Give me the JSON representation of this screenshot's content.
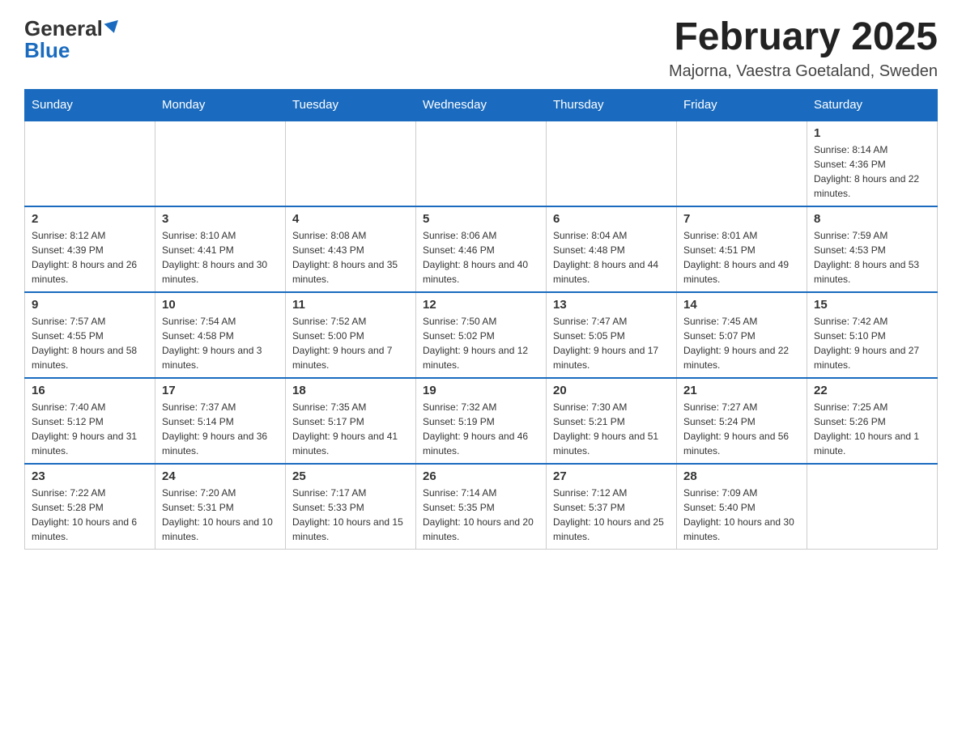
{
  "header": {
    "logo_main": "General",
    "logo_accent": "Blue",
    "month_title": "February 2025",
    "location": "Majorna, Vaestra Goetaland, Sweden"
  },
  "days_of_week": [
    "Sunday",
    "Monday",
    "Tuesday",
    "Wednesday",
    "Thursday",
    "Friday",
    "Saturday"
  ],
  "weeks": [
    [
      {
        "num": "",
        "info": ""
      },
      {
        "num": "",
        "info": ""
      },
      {
        "num": "",
        "info": ""
      },
      {
        "num": "",
        "info": ""
      },
      {
        "num": "",
        "info": ""
      },
      {
        "num": "",
        "info": ""
      },
      {
        "num": "1",
        "info": "Sunrise: 8:14 AM\nSunset: 4:36 PM\nDaylight: 8 hours and 22 minutes."
      }
    ],
    [
      {
        "num": "2",
        "info": "Sunrise: 8:12 AM\nSunset: 4:39 PM\nDaylight: 8 hours and 26 minutes."
      },
      {
        "num": "3",
        "info": "Sunrise: 8:10 AM\nSunset: 4:41 PM\nDaylight: 8 hours and 30 minutes."
      },
      {
        "num": "4",
        "info": "Sunrise: 8:08 AM\nSunset: 4:43 PM\nDaylight: 8 hours and 35 minutes."
      },
      {
        "num": "5",
        "info": "Sunrise: 8:06 AM\nSunset: 4:46 PM\nDaylight: 8 hours and 40 minutes."
      },
      {
        "num": "6",
        "info": "Sunrise: 8:04 AM\nSunset: 4:48 PM\nDaylight: 8 hours and 44 minutes."
      },
      {
        "num": "7",
        "info": "Sunrise: 8:01 AM\nSunset: 4:51 PM\nDaylight: 8 hours and 49 minutes."
      },
      {
        "num": "8",
        "info": "Sunrise: 7:59 AM\nSunset: 4:53 PM\nDaylight: 8 hours and 53 minutes."
      }
    ],
    [
      {
        "num": "9",
        "info": "Sunrise: 7:57 AM\nSunset: 4:55 PM\nDaylight: 8 hours and 58 minutes."
      },
      {
        "num": "10",
        "info": "Sunrise: 7:54 AM\nSunset: 4:58 PM\nDaylight: 9 hours and 3 minutes."
      },
      {
        "num": "11",
        "info": "Sunrise: 7:52 AM\nSunset: 5:00 PM\nDaylight: 9 hours and 7 minutes."
      },
      {
        "num": "12",
        "info": "Sunrise: 7:50 AM\nSunset: 5:02 PM\nDaylight: 9 hours and 12 minutes."
      },
      {
        "num": "13",
        "info": "Sunrise: 7:47 AM\nSunset: 5:05 PM\nDaylight: 9 hours and 17 minutes."
      },
      {
        "num": "14",
        "info": "Sunrise: 7:45 AM\nSunset: 5:07 PM\nDaylight: 9 hours and 22 minutes."
      },
      {
        "num": "15",
        "info": "Sunrise: 7:42 AM\nSunset: 5:10 PM\nDaylight: 9 hours and 27 minutes."
      }
    ],
    [
      {
        "num": "16",
        "info": "Sunrise: 7:40 AM\nSunset: 5:12 PM\nDaylight: 9 hours and 31 minutes."
      },
      {
        "num": "17",
        "info": "Sunrise: 7:37 AM\nSunset: 5:14 PM\nDaylight: 9 hours and 36 minutes."
      },
      {
        "num": "18",
        "info": "Sunrise: 7:35 AM\nSunset: 5:17 PM\nDaylight: 9 hours and 41 minutes."
      },
      {
        "num": "19",
        "info": "Sunrise: 7:32 AM\nSunset: 5:19 PM\nDaylight: 9 hours and 46 minutes."
      },
      {
        "num": "20",
        "info": "Sunrise: 7:30 AM\nSunset: 5:21 PM\nDaylight: 9 hours and 51 minutes."
      },
      {
        "num": "21",
        "info": "Sunrise: 7:27 AM\nSunset: 5:24 PM\nDaylight: 9 hours and 56 minutes."
      },
      {
        "num": "22",
        "info": "Sunrise: 7:25 AM\nSunset: 5:26 PM\nDaylight: 10 hours and 1 minute."
      }
    ],
    [
      {
        "num": "23",
        "info": "Sunrise: 7:22 AM\nSunset: 5:28 PM\nDaylight: 10 hours and 6 minutes."
      },
      {
        "num": "24",
        "info": "Sunrise: 7:20 AM\nSunset: 5:31 PM\nDaylight: 10 hours and 10 minutes."
      },
      {
        "num": "25",
        "info": "Sunrise: 7:17 AM\nSunset: 5:33 PM\nDaylight: 10 hours and 15 minutes."
      },
      {
        "num": "26",
        "info": "Sunrise: 7:14 AM\nSunset: 5:35 PM\nDaylight: 10 hours and 20 minutes."
      },
      {
        "num": "27",
        "info": "Sunrise: 7:12 AM\nSunset: 5:37 PM\nDaylight: 10 hours and 25 minutes."
      },
      {
        "num": "28",
        "info": "Sunrise: 7:09 AM\nSunset: 5:40 PM\nDaylight: 10 hours and 30 minutes."
      },
      {
        "num": "",
        "info": ""
      }
    ]
  ]
}
